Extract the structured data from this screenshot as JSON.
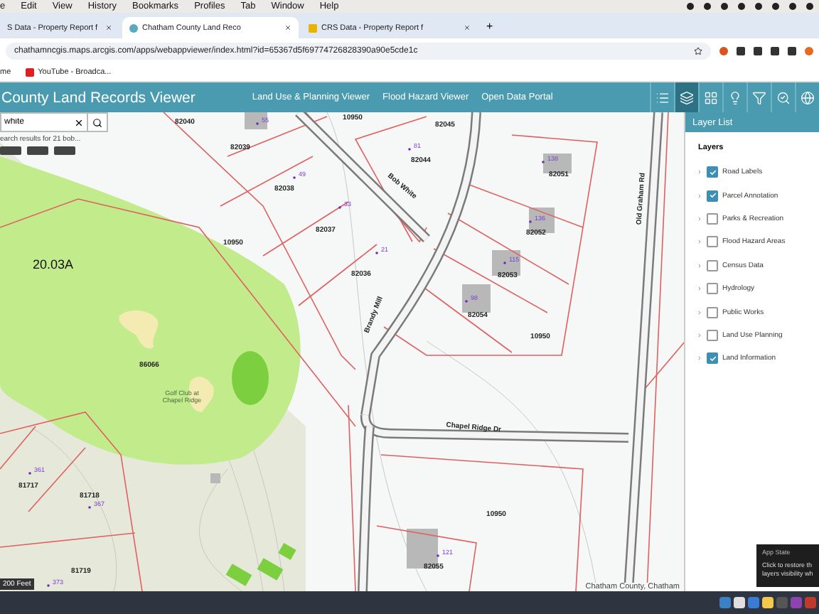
{
  "menu_bar": {
    "items": [
      "e",
      "Edit",
      "View",
      "History",
      "Bookmarks",
      "Profiles",
      "Tab",
      "Window",
      "Help"
    ]
  },
  "browser": {
    "tabs": [
      {
        "title": "S Data - Property Report f",
        "selected": false
      },
      {
        "title": "Chatham County Land Reco",
        "selected": true
      },
      {
        "title": "CRS Data - Property Report f",
        "selected": false
      }
    ],
    "new_tab": "+",
    "address": "chathamncgis.maps.arcgis.com/apps/webappviewer/index.html?id=65367d5f69774726828390a90e5cde1c",
    "bookmarks": [
      "me",
      "YouTube - Broadca..."
    ]
  },
  "app": {
    "title": "County Land Records Viewer",
    "nav_links": [
      "Land Use & Planning Viewer",
      "Flood Hazard Viewer",
      "Open Data Portal"
    ],
    "toolbar": [
      {
        "kind": "list",
        "selected": false
      },
      {
        "kind": "layers",
        "selected": true
      },
      {
        "kind": "grid",
        "selected": false
      },
      {
        "kind": "bulb",
        "selected": false
      },
      {
        "kind": "filter",
        "selected": false
      },
      {
        "kind": "search",
        "selected": false
      },
      {
        "kind": "globe",
        "selected": false
      }
    ]
  },
  "search": {
    "value": "white",
    "results": "earch results for 21 bob..."
  },
  "map": {
    "parcel_labels": [
      "82040",
      "82039",
      "10950",
      "82045",
      "82044",
      "82051",
      "82038",
      "82037",
      "82036",
      "10950",
      "82052",
      "82053",
      "82054",
      "10950",
      "86066",
      "81717",
      "81718",
      "81719",
      "10950",
      "82055"
    ],
    "address_points": [
      "55",
      "49",
      "33",
      "21",
      "81",
      "138",
      "136",
      "115",
      "98",
      "361",
      "367",
      "373",
      "121"
    ],
    "road_labels": [
      "Bob White",
      "Brandy Mill",
      "Old Graham Rd",
      "Chapel Ridge Dr"
    ],
    "acreage": "20.03A",
    "place_label": [
      "Golf Club at",
      "Chapel Ridge"
    ],
    "scale": "200 Feet",
    "attribution": "Chatham County, Chatham"
  },
  "layer_list": {
    "title": "Layer List",
    "heading": "Layers",
    "layers": [
      {
        "label": "Road Labels",
        "checked": true
      },
      {
        "label": "Parcel Annotation",
        "checked": true
      },
      {
        "label": "Parks & Recreation",
        "checked": false
      },
      {
        "label": "Flood Hazard Areas",
        "checked": false
      },
      {
        "label": "Census Data",
        "checked": false
      },
      {
        "label": "Hydrology",
        "checked": false
      },
      {
        "label": "Public Works",
        "checked": false
      },
      {
        "label": "Land Use Planning",
        "checked": false
      },
      {
        "label": "Land Information",
        "checked": true
      }
    ]
  },
  "tooltip": {
    "title": "App State",
    "lines": [
      "Click to restore th",
      "layers visibility wh"
    ]
  }
}
